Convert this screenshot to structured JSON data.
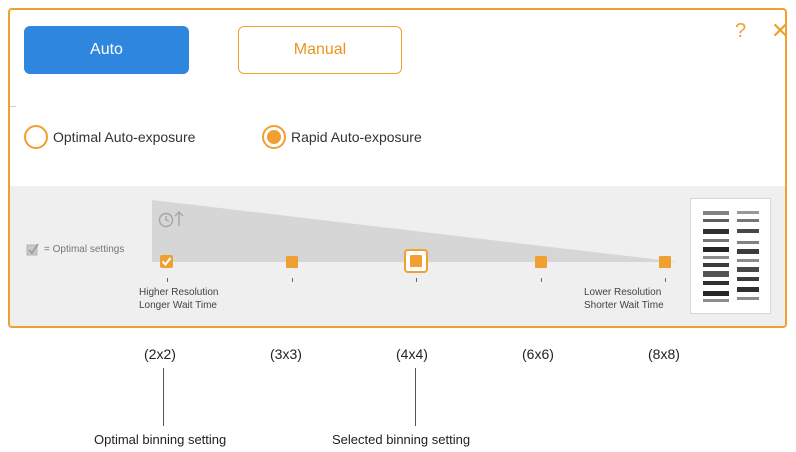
{
  "mode_tabs": {
    "auto_label": "Auto",
    "manual_label": "Manual"
  },
  "window_controls": {
    "help_glyph": "?",
    "close_glyph": "✕"
  },
  "exposure_options": [
    {
      "label": "Optimal Auto-exposure",
      "selected": false
    },
    {
      "label": "Rapid Auto-exposure",
      "selected": true
    }
  ],
  "legend": {
    "text": "= Optimal settings",
    "icon": "checkbox-check-icon"
  },
  "ramp_icon": "clock-arrow-up-icon",
  "binning_steps": [
    {
      "label": "(2x2)",
      "optimal": true,
      "selected": false
    },
    {
      "label": "(3x3)",
      "optimal": false,
      "selected": false
    },
    {
      "label": "(4x4)",
      "optimal": false,
      "selected": true
    },
    {
      "label": "(6x6)",
      "optimal": false,
      "selected": false
    },
    {
      "label": "(8x8)",
      "optimal": false,
      "selected": false
    }
  ],
  "end_labels": {
    "left_line1": "Higher Resolution",
    "left_line2": "Longer Wait Time",
    "right_line1": "Lower Resolution",
    "right_line2": "Shorter Wait Time"
  },
  "callouts": {
    "optimal": "Optimal binning setting",
    "selected": "Selected binning setting"
  },
  "colors": {
    "accent": "#F0A030",
    "primary_button": "#2E86DE",
    "ramp": "#d6d6d6",
    "panel_bg": "#efefef"
  }
}
